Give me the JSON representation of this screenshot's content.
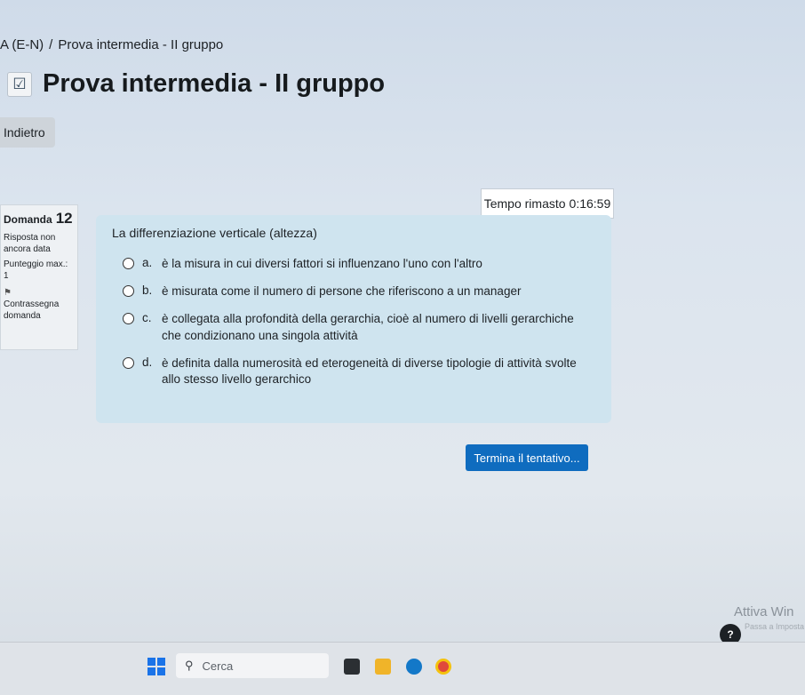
{
  "breadcrumb": {
    "course": "A (E-N)",
    "separator": "/",
    "current": "Prova intermedia - II gruppo"
  },
  "page": {
    "title": "Prova intermedia - II gruppo",
    "icon": "quiz-icon"
  },
  "back_label": "Indietro",
  "timer": {
    "label": "Tempo rimasto",
    "value": "0:16:59"
  },
  "question_info": {
    "number_label": "Domanda",
    "number": "12",
    "status": "Risposta non ancora data",
    "max_points_label": "Punteggio max.:",
    "max_points": "1",
    "flag_label": "Contrassegna domanda"
  },
  "question": {
    "text": "La differenziazione verticale (altezza)",
    "options": [
      {
        "letter": "a.",
        "text": "è la misura in cui diversi fattori si influenzano l'uno con l'altro"
      },
      {
        "letter": "b.",
        "text": "è misurata come il numero di persone che riferiscono a un manager"
      },
      {
        "letter": "c.",
        "text": "è collegata alla profondità della gerarchia, cioè al numero di livelli gerarchiche che condizionano una singola attività"
      },
      {
        "letter": "d.",
        "text": "è definita dalla numerosità ed eterogeneità di diverse tipologie di attività svolte allo stesso livello gerarchico"
      }
    ]
  },
  "finish_label": "Termina il tentativo...",
  "help_label": "?",
  "watermark": {
    "title": "Attiva Win",
    "subtitle": "Passa a Imposta"
  },
  "taskbar": {
    "search_placeholder": "Cerca"
  },
  "colors": {
    "accent": "#0f6cbf",
    "question_bg": "#cfe4ef"
  }
}
